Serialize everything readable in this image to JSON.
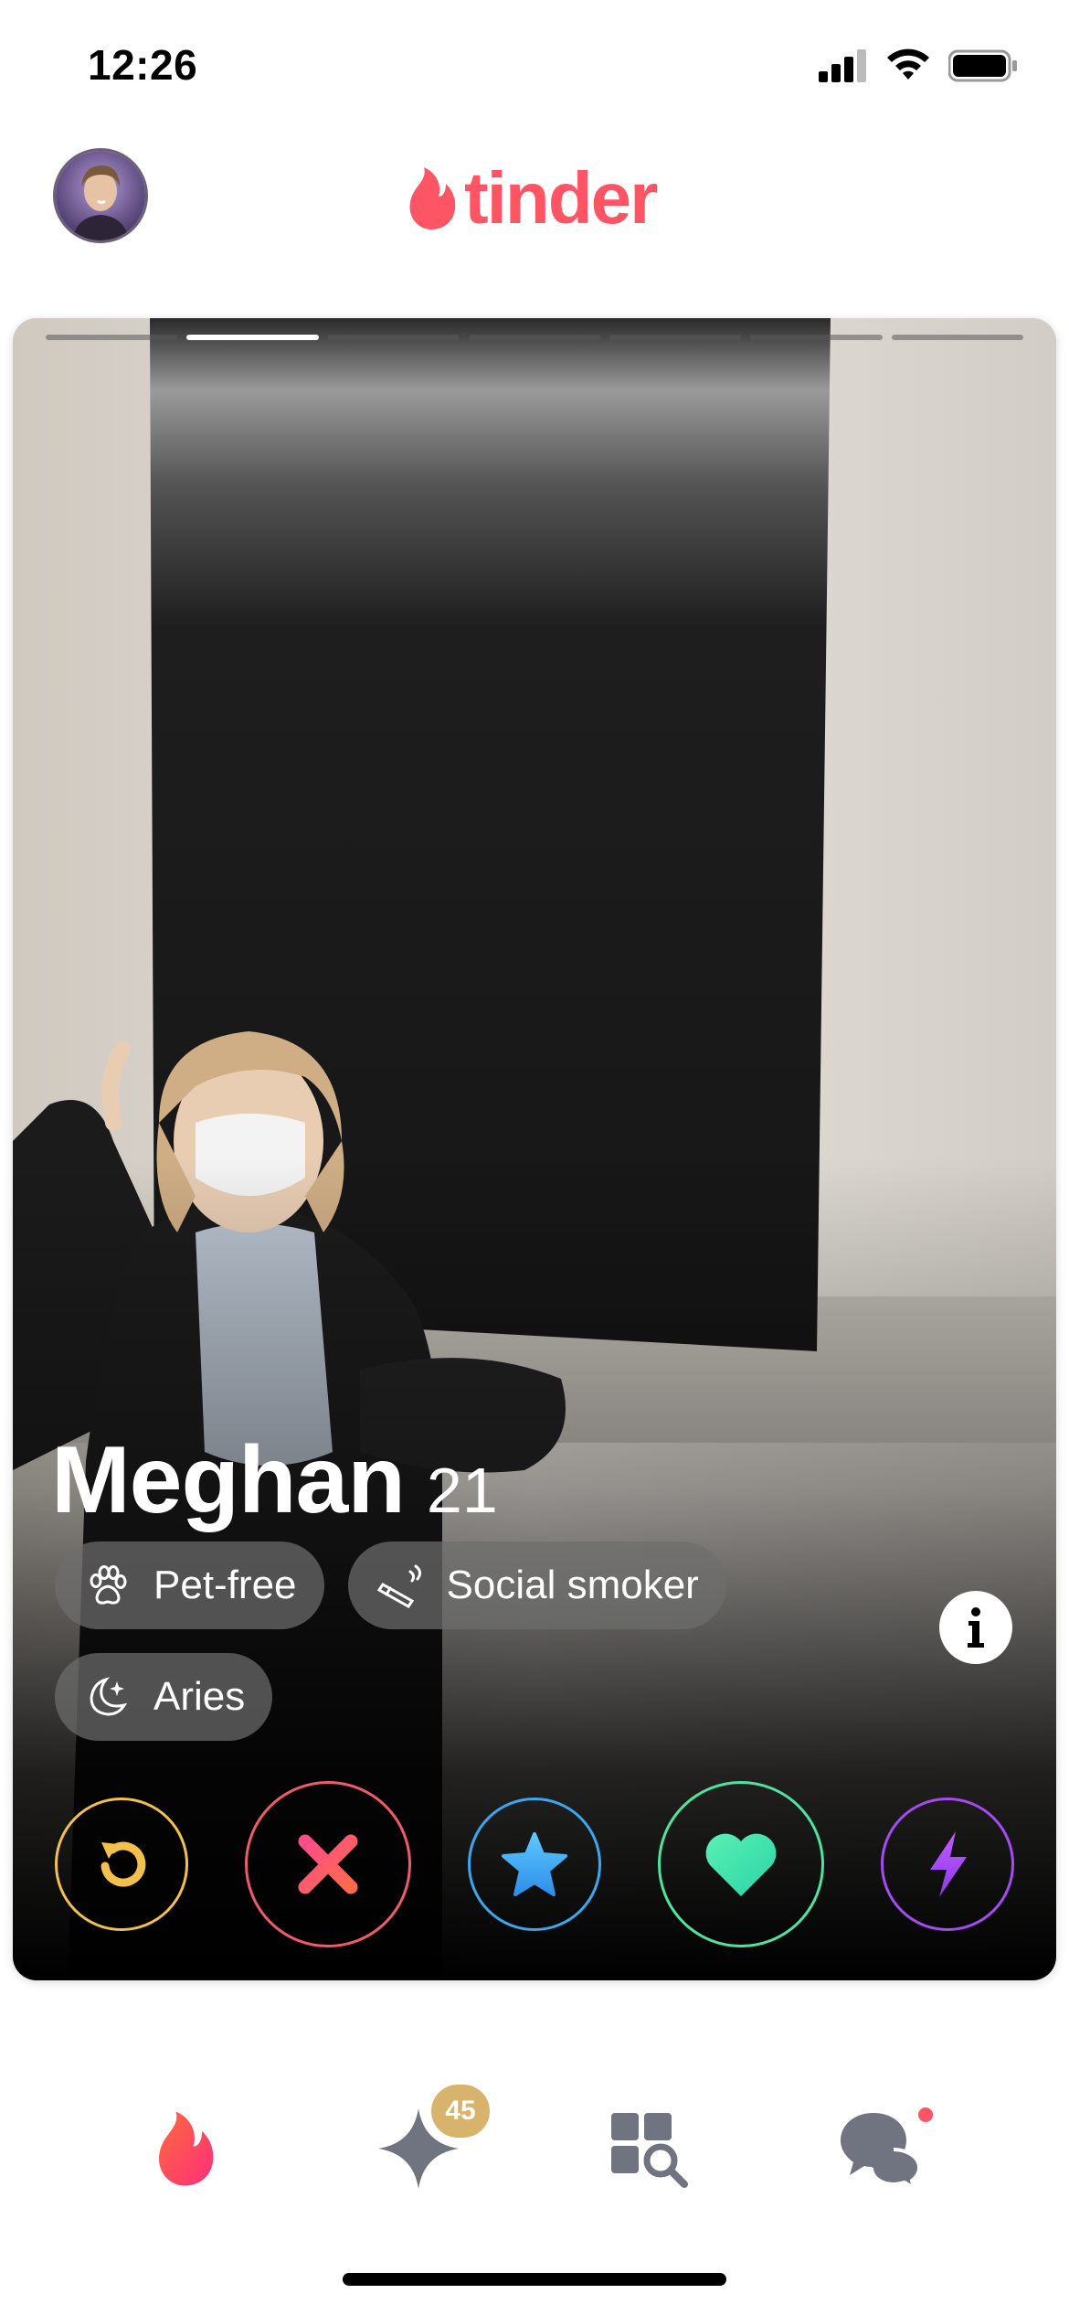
{
  "status_bar": {
    "time": "12:26"
  },
  "header": {
    "logo_text": "tinder"
  },
  "card": {
    "name": "Meghan",
    "age": "21",
    "photo_count": 7,
    "active_photo_index": 1,
    "chips": [
      {
        "icon": "paw-icon",
        "label": "Pet-free"
      },
      {
        "icon": "cigarette-icon",
        "label": "Social smoker"
      },
      {
        "icon": "moon-icon",
        "label": "Aries"
      }
    ]
  },
  "actions": [
    {
      "name": "rewind",
      "color": "#f1c04d"
    },
    {
      "name": "nope",
      "color": "#f05a6a"
    },
    {
      "name": "super-like",
      "color": "#3aa7ef"
    },
    {
      "name": "like",
      "color": "#4ee3a0"
    },
    {
      "name": "boost",
      "color": "#a44bf2"
    }
  ],
  "nav": {
    "likes_badge": "45",
    "items": [
      "flame-icon",
      "sparkle-icon",
      "explore-icon",
      "chat-icon"
    ]
  },
  "colors": {
    "brand": "#fd5564",
    "badge": "#d8b36b"
  }
}
